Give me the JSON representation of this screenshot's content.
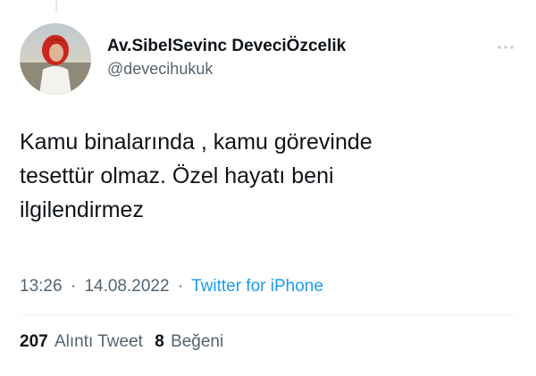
{
  "author": {
    "display_name": "Av.SibelSevinc DeveciÖzcelik",
    "handle": "@devecihukuk",
    "avatar_icon": "profile-photo"
  },
  "tweet": {
    "text": "Kamu binalarında , kamu görevinde\ntesettür olmaz. Özel hayatı beni\nilgilendirmez",
    "time": "13:26",
    "separator": "·",
    "date": "14.08.2022",
    "source": "Twitter for iPhone"
  },
  "stats": {
    "quote_tweets_count": "207",
    "quote_tweets_label": "Alıntı Tweet",
    "likes_count": "8",
    "likes_label": "Beğeni"
  },
  "icons": {
    "more": "more-options-icon"
  },
  "colors": {
    "text_primary": "#0f1419",
    "text_secondary": "#536471",
    "link": "#1d9bf0",
    "divider": "#eff3f4",
    "background": "#ffffff"
  }
}
